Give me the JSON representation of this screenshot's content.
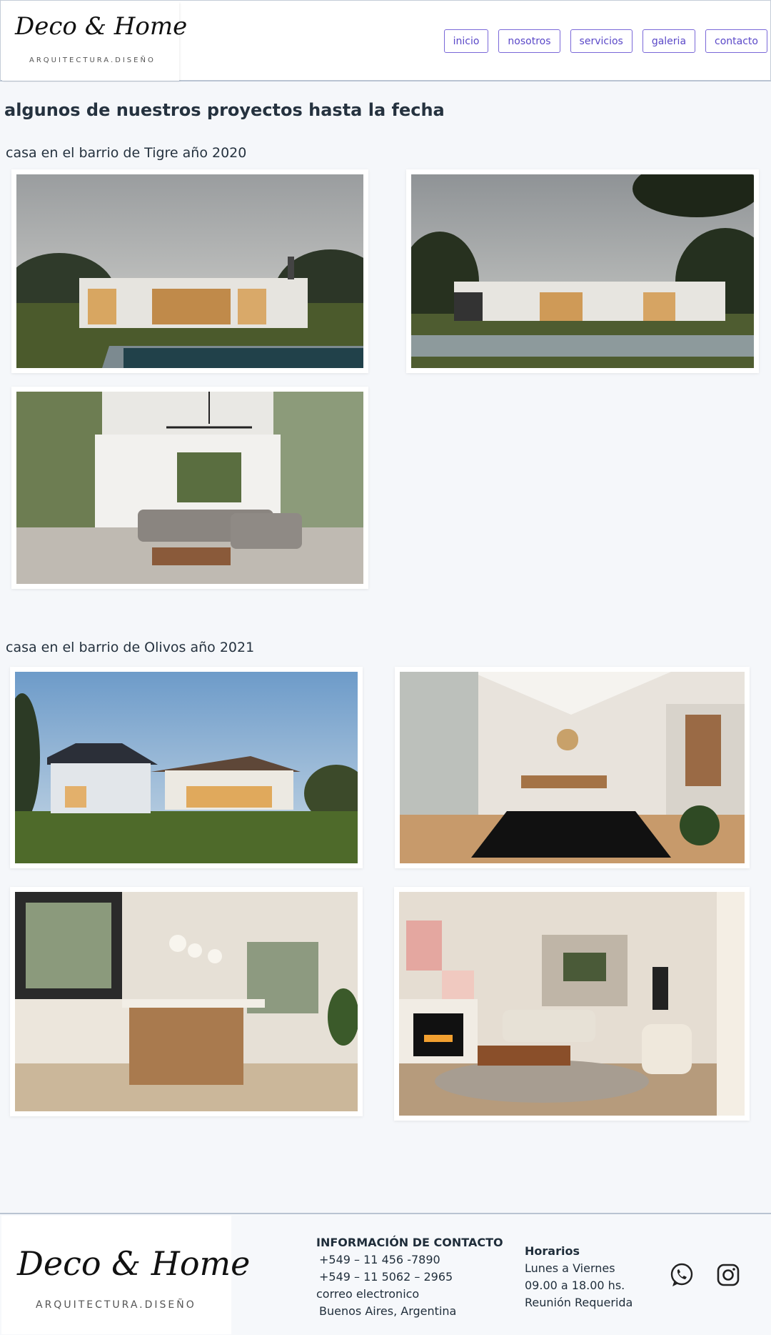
{
  "header": {
    "logo": {
      "brand": "Deco & Home",
      "tagline": "ARQUITECTURA.DISEÑO"
    },
    "nav": [
      {
        "label": "inicio"
      },
      {
        "label": "nosotros"
      },
      {
        "label": "servicios"
      },
      {
        "label": "galeria"
      },
      {
        "label": "contacto"
      }
    ]
  },
  "main": {
    "title": "algunos de nuestros proyectos hasta la fecha",
    "sections": [
      {
        "title": "casa en el barrio de Tigre año 2020"
      },
      {
        "title": "casa en el barrio de Olivos año 2021"
      }
    ]
  },
  "footer": {
    "logo": {
      "brand": "Deco & Home",
      "tagline": "ARQUITECTURA.DISEÑO"
    },
    "contact": {
      "heading": "INFORMACIÓN DE CONTACTO",
      "phone1": "+549 – 11 456  -7890",
      "phone2": "+549 – 11 5062 – 2965",
      "email_label": "correo electronico",
      "location": "Buenos Aires, Argentina"
    },
    "hours": {
      "heading": "Horarios",
      "days": "Lunes a Viernes",
      "time": "09.00 a 18.00 hs.",
      "note": "Reunión Requerida"
    },
    "social": [
      {
        "icon": "whatsapp-icon"
      },
      {
        "icon": "instagram-icon"
      }
    ]
  },
  "colors": {
    "nav_accent": "#5a48c8",
    "text": "#25323f",
    "background": "#f5f7fa"
  }
}
